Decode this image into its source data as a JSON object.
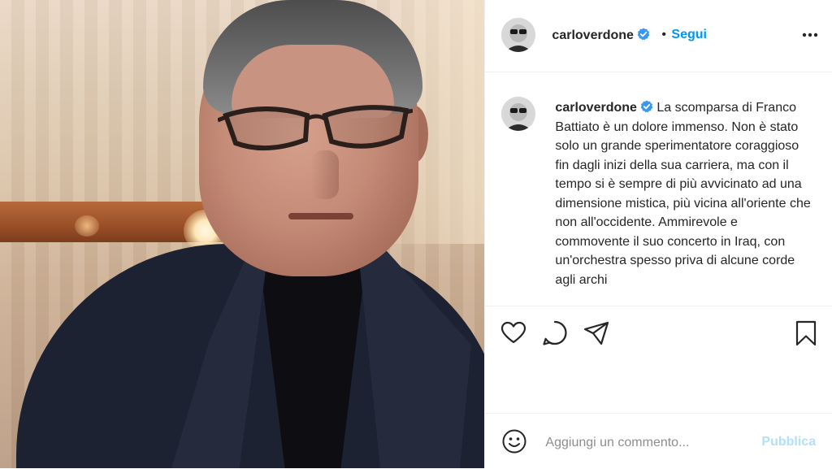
{
  "header": {
    "username": "carloverdone",
    "separator": "•",
    "follow_label": "Segui"
  },
  "caption": {
    "username": "carloverdone",
    "text": "La scomparsa di Franco Battiato è un dolore immenso. Non è stato solo un grande sperimentatore coraggioso fin dagli inizi della sua carriera, ma con il tempo si è sempre di più avvicinato ad una dimensione mistica, più vicina all'oriente che non all'occidente. Ammirevole e commovente il suo concerto in Iraq, con un'orchestra spesso priva di alcune corde agli archi"
  },
  "actions": {
    "icons": [
      "heart-icon",
      "comment-icon",
      "share-icon",
      "bookmark-icon"
    ]
  },
  "comment": {
    "placeholder": "Aggiungi un commento...",
    "publish_label": "Pubblica"
  },
  "colors": {
    "accent": "#0095f6",
    "publish_disabled": "#b2dffc",
    "verified": "#3897f0",
    "text": "#262626",
    "muted": "#8e8e8e",
    "border": "#efefef"
  }
}
